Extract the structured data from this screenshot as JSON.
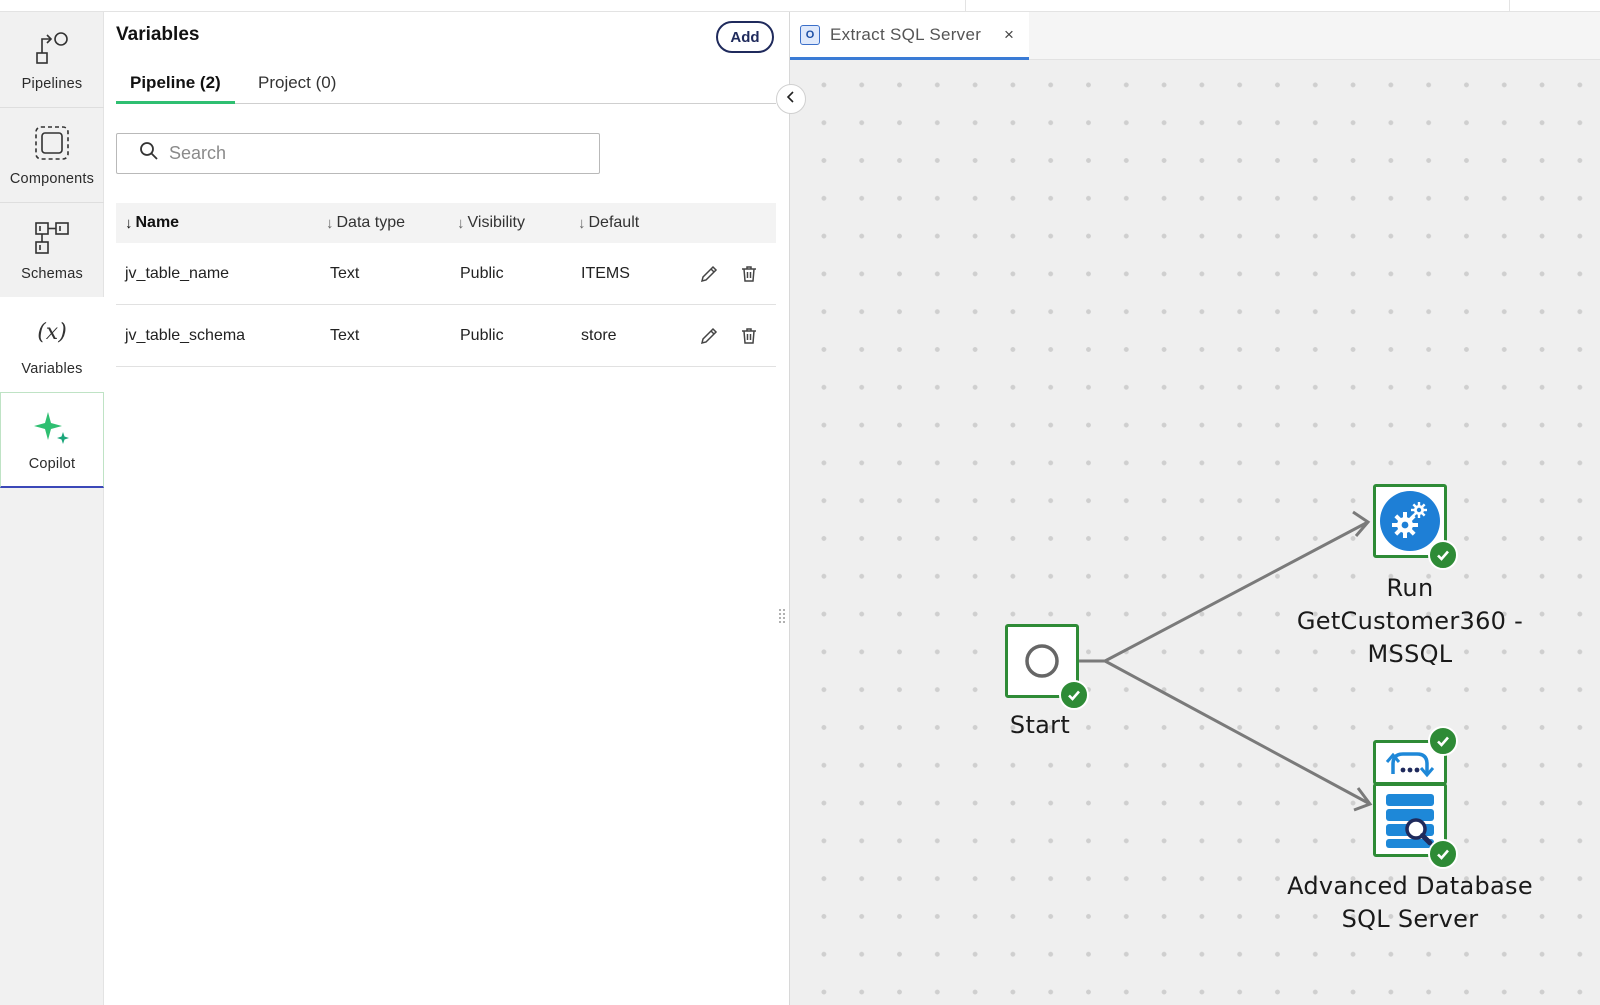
{
  "panel": {
    "title": "Variables",
    "add_label": "Add",
    "tabs": [
      {
        "label": "Pipeline (2)",
        "active": true
      },
      {
        "label": "Project (0)",
        "active": false
      }
    ],
    "search_placeholder": "Search",
    "columns": [
      {
        "label": "Name",
        "arrow": "↓"
      },
      {
        "label": "Data type",
        "arrow": "↓"
      },
      {
        "label": "Visibility",
        "arrow": "↓"
      },
      {
        "label": "Default",
        "arrow": "↓"
      }
    ],
    "rows": [
      {
        "name": "jv_table_name",
        "type": "Text",
        "visibility": "Public",
        "default": "ITEMS"
      },
      {
        "name": "jv_table_schema",
        "type": "Text",
        "visibility": "Public",
        "default": "store"
      }
    ]
  },
  "rail": {
    "items": [
      {
        "label": "Pipelines",
        "icon": "pipelines-icon"
      },
      {
        "label": "Components",
        "icon": "components-icon"
      },
      {
        "label": "Schemas",
        "icon": "schemas-icon"
      },
      {
        "label": "Variables",
        "icon": "variables-icon",
        "active": true
      },
      {
        "label": "Copilot",
        "icon": "sparkle-icon"
      }
    ],
    "variables_glyph": "(x)"
  },
  "canvas": {
    "tab": {
      "label": "Extract SQL Server",
      "icon_letter": "O",
      "close": "×"
    },
    "nodes": {
      "start": {
        "label": "Start",
        "status": "success"
      },
      "run": {
        "label_lines": [
          "Run",
          "GetCustomer360 -",
          "MSSQL"
        ],
        "status": "success"
      },
      "advanced": {
        "label_lines": [
          "Advanced Database",
          "SQL Server"
        ],
        "status": "success"
      }
    }
  },
  "colors": {
    "accent_green": "#2fbf71",
    "node_border": "#2e8b36",
    "check": "#2e8b36",
    "add_button": "#1f2a5c",
    "run_icon": "#1e7fd6",
    "db_icon": "#1e88d8",
    "connector": "#7a7a7a"
  }
}
